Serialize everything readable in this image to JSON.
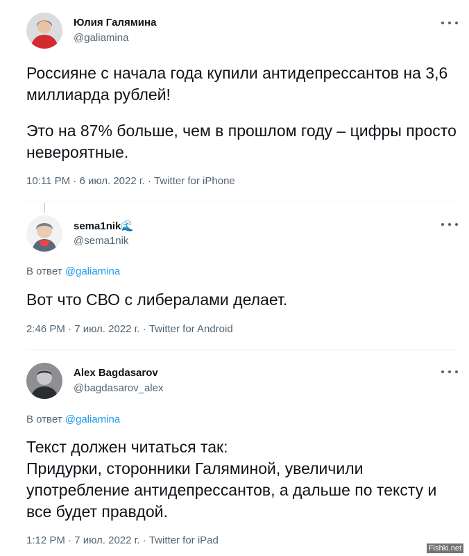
{
  "tweets": [
    {
      "name": "Юлия Галямина",
      "handle": "@galiamina",
      "text_p1": "Россияне с начала года купили антидепрессантов на 3,6 миллиарда рублей!",
      "text_p2": "Это на 87% больше, чем в прошлом году – цифры просто невероятные.",
      "time": "10:11 PM",
      "date": "6 июл. 2022 г.",
      "source": "Twitter for iPhone"
    },
    {
      "name": "sema1nik",
      "name_emoji": "🌊",
      "handle": "@sema1nik",
      "reply_prefix": "В ответ",
      "reply_mention": "@galiamina",
      "text": "Вот что СВО с  либералами делает.",
      "time": "2:46 PM",
      "date": "7 июл. 2022 г.",
      "source": "Twitter for Android"
    },
    {
      "name": "Alex Bagdasarov",
      "handle": "@bagdasarov_alex",
      "reply_prefix": "В ответ",
      "reply_mention": "@galiamina",
      "text": "Текст должен читаться так:\nПридурки, сторонники Галяминой, увеличили употребление антидепрессантов, а дальше по тексту и все будет правдой.",
      "time": "1:12 PM",
      "date": "7 июл. 2022 г.",
      "source": "Twitter for iPad"
    }
  ],
  "separator": "·",
  "watermark": "Fishki.net",
  "icons": {
    "more": "more-options-icon"
  }
}
